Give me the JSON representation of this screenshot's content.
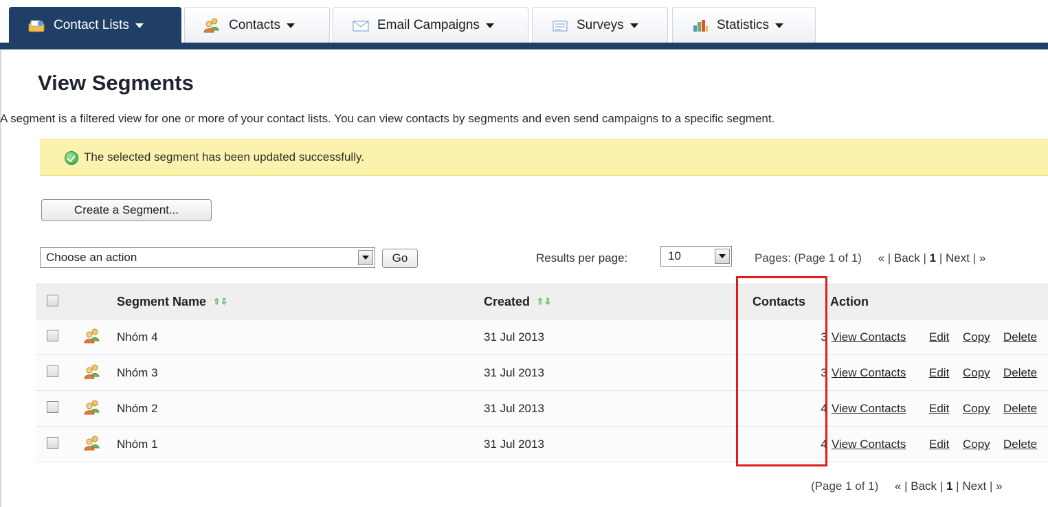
{
  "nav": {
    "tabs": [
      {
        "label": "Contact Lists",
        "icon": "contact-lists-icon",
        "active": true
      },
      {
        "label": "Contacts",
        "icon": "contacts-icon",
        "active": false
      },
      {
        "label": "Email Campaigns",
        "icon": "email-icon",
        "active": false
      },
      {
        "label": "Surveys",
        "icon": "survey-icon",
        "active": false
      },
      {
        "label": "Statistics",
        "icon": "statistics-icon",
        "active": false
      }
    ],
    "active_color": "#1f3f66"
  },
  "page": {
    "title": "View Segments",
    "description": "A segment is a filtered view for one or more of your contact lists. You can view contacts by segments and even send campaigns to a specific segment."
  },
  "message": {
    "text": "The selected segment has been updated successfully.",
    "icon": "success-check-icon",
    "background": "#fbf3ad"
  },
  "toolbar": {
    "create_label": "Create a Segment...",
    "action_value": "Choose an action",
    "go_label": "Go",
    "results_label": "Results per page:",
    "results_value": "10",
    "pages_label": "Pages: (Page 1 of 1)",
    "first_link": "«",
    "back_link": "Back",
    "current_page": "1",
    "next_link": "Next",
    "last_link": "»"
  },
  "table": {
    "headers": {
      "segment_name": "Segment Name",
      "created": "Created",
      "contacts": "Contacts",
      "action": "Action"
    },
    "sort_arrows": "⇧⇩",
    "row_icon": "segment-group-icon",
    "action_links": {
      "view": "View Contacts",
      "edit": "Edit",
      "copy": "Copy",
      "delete": "Delete"
    },
    "rows": [
      {
        "name": "Nhóm 4",
        "created": "31 Jul 2013",
        "contacts": "3"
      },
      {
        "name": "Nhóm 3",
        "created": "31 Jul 2013",
        "contacts": "3"
      },
      {
        "name": "Nhóm 2",
        "created": "31 Jul 2013",
        "contacts": "4"
      },
      {
        "name": "Nhóm 1",
        "created": "31 Jul 2013",
        "contacts": "4"
      }
    ]
  },
  "pager_bottom": {
    "label": "(Page 1 of 1)",
    "first_link": "«",
    "back_link": "Back",
    "current_page": "1",
    "next_link": "Next",
    "last_link": "»"
  },
  "highlight": {
    "color": "#e01b1b"
  }
}
